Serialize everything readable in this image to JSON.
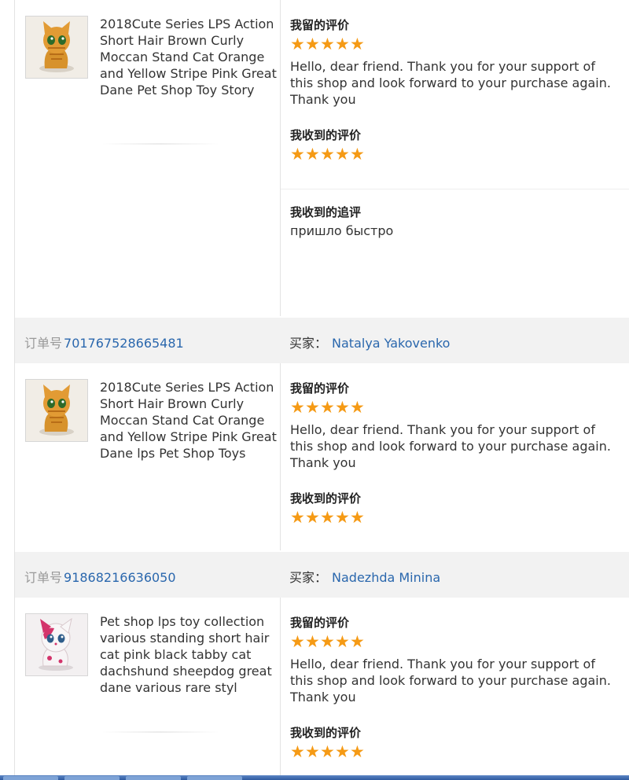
{
  "labels": {
    "my_review": "我留的评价",
    "received_review": "我收到的评价",
    "received_followup": "我收到的追评",
    "order_prefix": "订单号",
    "buyer_prefix": "买家："
  },
  "stars_glyph": "★",
  "star_color": "#f59a15",
  "link_color": "#2a67ad",
  "entries": [
    {
      "product_title": "2018Cute Series LPS Action Short Hair Brown Curly Moccan Stand Cat Orange and Yellow Stripe Pink Great Dane Pet Shop Toy Story",
      "thumb_icon": "orange-cat-toy-photo",
      "my_rating": 5,
      "my_comment": "Hello, dear friend. Thank you for your support of this shop and look forward to your purchase again. Thank you",
      "received_rating": 5,
      "followup": "пришло быстро"
    },
    {
      "order_number": "701767528665481",
      "buyer": "Natalya Yakovenko",
      "product_title": "2018Cute Series LPS Action Short Hair Brown Curly Moccan Stand Cat Orange and Yellow Stripe Pink Great Dane lps Pet Shop Toys",
      "thumb_icon": "orange-cat-toy-photo",
      "my_rating": 5,
      "my_comment": "Hello, dear friend. Thank you for your support of this shop and look forward to your purchase again. Thank you",
      "received_rating": 5
    },
    {
      "order_number": "91868216636050",
      "buyer": "Nadezhda Minina",
      "product_title": "Pet shop lps toy collection various standing short hair cat pink black tabby cat dachshund sheepdog great dane various rare styl",
      "thumb_icon": "pink-cat-toy-photo",
      "my_rating": 5,
      "my_comment": "Hello, dear friend. Thank you for your support of this shop and look forward to your purchase again. Thank you",
      "received_rating": 5
    }
  ]
}
